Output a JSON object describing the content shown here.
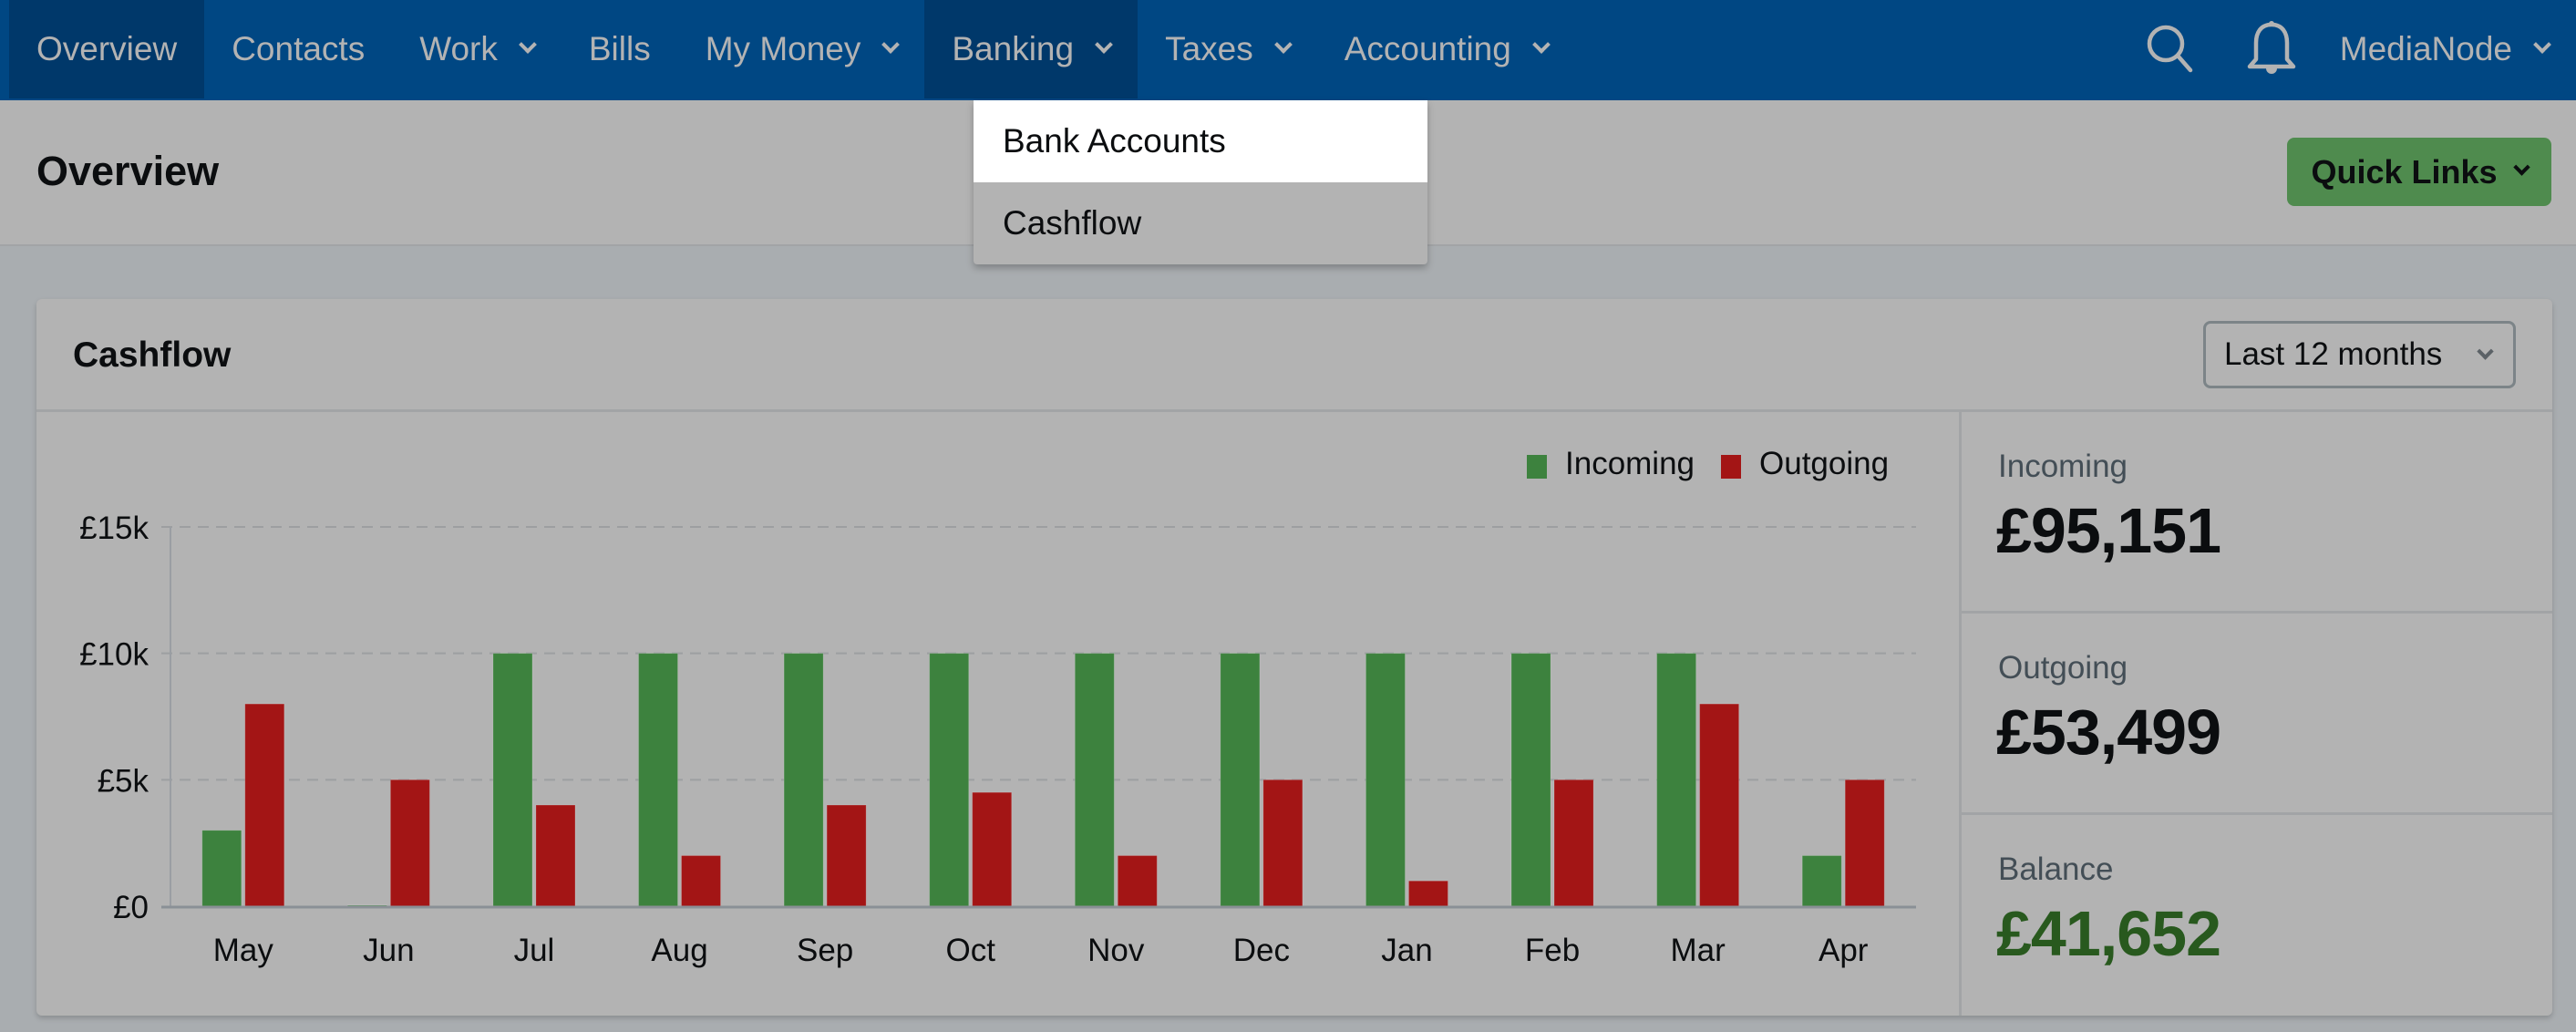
{
  "nav": {
    "items": [
      {
        "label": "Overview",
        "has_dropdown": false,
        "active": true
      },
      {
        "label": "Contacts",
        "has_dropdown": false,
        "active": false
      },
      {
        "label": "Work",
        "has_dropdown": true,
        "active": false
      },
      {
        "label": "Bills",
        "has_dropdown": false,
        "active": false
      },
      {
        "label": "My Money",
        "has_dropdown": true,
        "active": false
      },
      {
        "label": "Banking",
        "has_dropdown": true,
        "active": true
      },
      {
        "label": "Taxes",
        "has_dropdown": true,
        "active": false
      },
      {
        "label": "Accounting",
        "has_dropdown": true,
        "active": false
      }
    ],
    "search_icon": "search-icon",
    "notification_icon": "bell-icon",
    "user_label": "MediaNode"
  },
  "banking_dropdown": {
    "items": [
      {
        "label": "Bank Accounts",
        "highlighted": true
      },
      {
        "label": "Cashflow",
        "highlighted": false
      }
    ]
  },
  "page": {
    "title": "Overview",
    "quick_links_label": "Quick Links"
  },
  "cashflow_card": {
    "title": "Cashflow",
    "range_select_value": "Last 12 months",
    "stats": [
      {
        "label": "Incoming",
        "value": "£95,151"
      },
      {
        "label": "Outgoing",
        "value": "£53,499"
      },
      {
        "label": "Balance",
        "value": "£41,652"
      }
    ]
  },
  "colors": {
    "nav_bg": "#004783",
    "nav_active_bg": "#00386a",
    "incoming": "#3d823e",
    "outgoing": "#a31515",
    "balance_text": "#28591e",
    "quick_links_bg": "#4f8b4e"
  },
  "chart_data": {
    "type": "bar",
    "title": "",
    "xlabel": "",
    "ylabel": "",
    "categories": [
      "May",
      "Jun",
      "Jul",
      "Aug",
      "Sep",
      "Oct",
      "Nov",
      "Dec",
      "Jan",
      "Feb",
      "Mar",
      "Apr"
    ],
    "series": [
      {
        "name": "Incoming",
        "color": "#3d823e",
        "values": [
          3000,
          0,
          10000,
          10000,
          10000,
          10000,
          10000,
          10000,
          10000,
          10000,
          10000,
          2000
        ]
      },
      {
        "name": "Outgoing",
        "color": "#a31515",
        "values": [
          8000,
          5000,
          4000,
          2000,
          4000,
          4500,
          2000,
          5000,
          1000,
          5000,
          8000,
          5000
        ]
      }
    ],
    "ylim": [
      0,
      15000
    ],
    "yticks": [
      0,
      5000,
      10000,
      15000
    ],
    "ytick_labels": [
      "£0",
      "£5k",
      "£10k",
      "£15k"
    ],
    "grid": "horizontal-dashed",
    "legend": "top-right"
  }
}
